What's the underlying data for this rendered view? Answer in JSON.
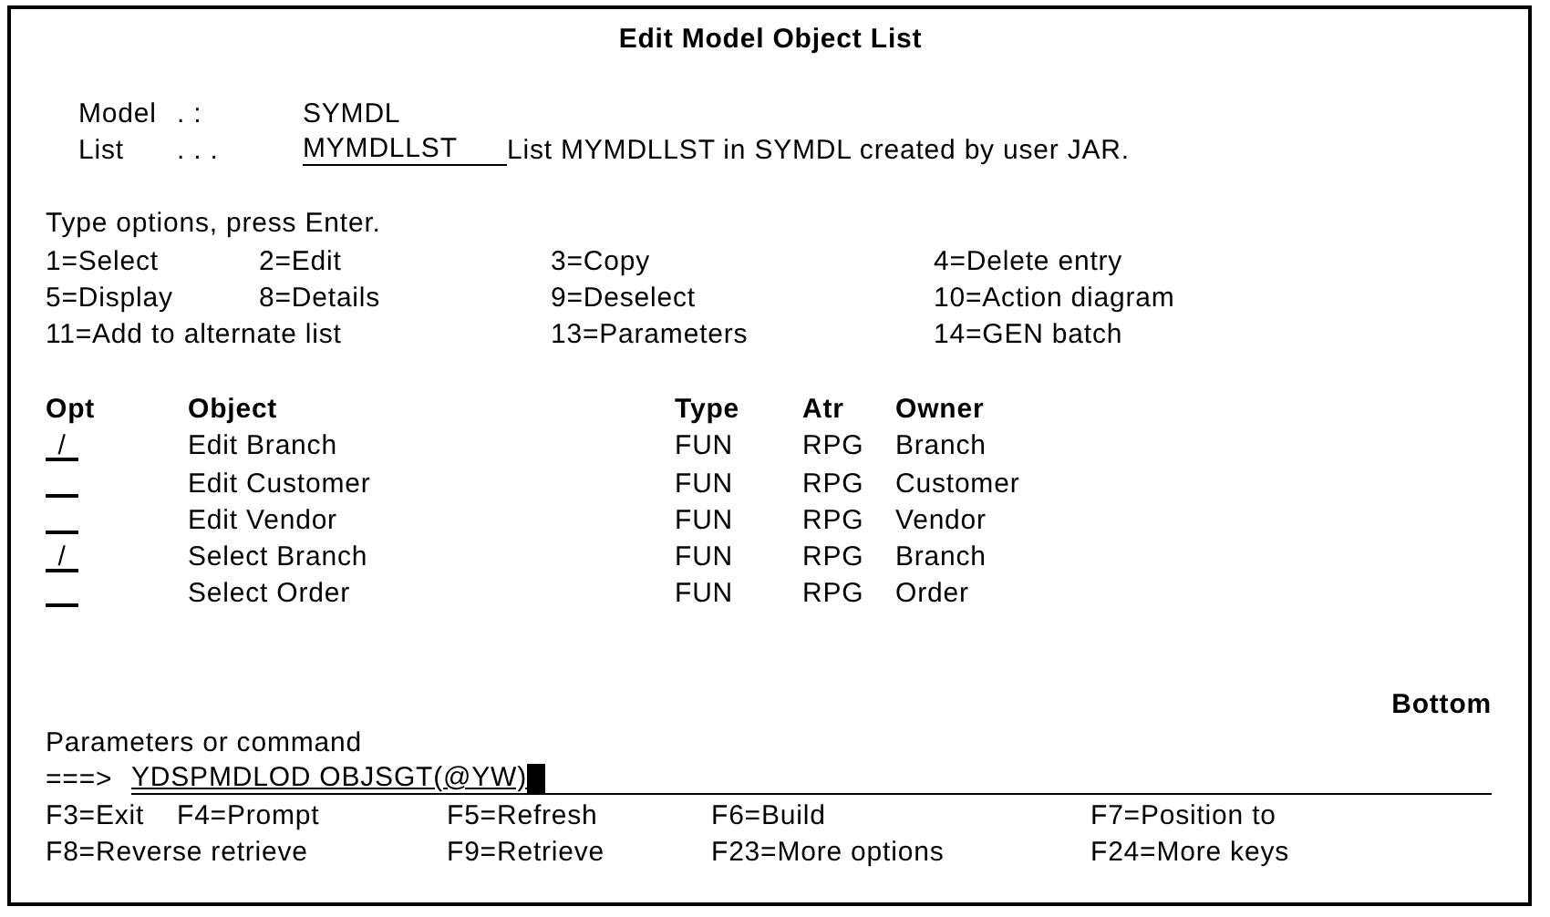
{
  "title": "Edit Model Object List",
  "header_fields": [
    {
      "label": "Model",
      "dots": ". :",
      "value": "SYMDL",
      "editable": false
    },
    {
      "label": "List",
      "dots": ". . .",
      "value": "MYMDLLST",
      "editable": true,
      "description": "List MYMDLLST in SYMDL created by user JAR."
    }
  ],
  "instruction": "Type options, press Enter.",
  "options": [
    [
      "1=Select",
      "2=Edit",
      "3=Copy",
      "4=Delete entry"
    ],
    [
      "5=Display",
      "8=Details",
      "9=Deselect",
      "10=Action diagram"
    ],
    [
      "11=Add to alternate list",
      "13=Parameters",
      "14=GEN batch"
    ]
  ],
  "columns": [
    "Opt",
    "Object",
    "Type",
    "Atr",
    "Owner"
  ],
  "rows": [
    {
      "opt": "/",
      "object": "Edit Branch",
      "type": "FUN",
      "atr": "RPG",
      "owner": "Branch"
    },
    {
      "object": "Edit Customer",
      "type": "FUN",
      "atr": "RPG",
      "owner": "Customer"
    },
    {
      "object": "Edit Vendor",
      "type": "FUN",
      "atr": "RPG",
      "owner": "Vendor"
    },
    {
      "opt": "/",
      "object": "Select Branch",
      "type": "FUN",
      "atr": "RPG",
      "owner": "Branch"
    },
    {
      "object": "Select Order",
      "type": "FUN",
      "atr": "RPG",
      "owner": "Order"
    }
  ],
  "more_indicator": "Bottom",
  "command": {
    "label": "Parameters or command",
    "prompt": "===>",
    "value": "YDSPMDLOD OBJSGT(@YW)"
  },
  "function_keys": [
    [
      "F3=Exit",
      "F4=Prompt",
      "F5=Refresh",
      "F6=Build",
      "F7=Position to"
    ],
    [
      "F8=Reverse retrieve",
      "F9=Retrieve",
      "F23=More options",
      "F24=More keys"
    ]
  ]
}
